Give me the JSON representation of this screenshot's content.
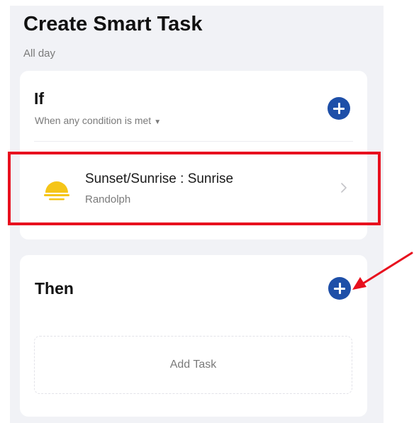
{
  "header": {
    "title": "Create Smart Task",
    "subtitle": "All day"
  },
  "if_section": {
    "title": "If",
    "condition_mode": "When any condition is met",
    "add_icon": "plus-circle-icon",
    "condition": {
      "icon": "sunrise-icon",
      "name": "Sunset/Sunrise : Sunrise",
      "location": "Randolph"
    }
  },
  "then_section": {
    "title": "Then",
    "add_icon": "plus-circle-icon",
    "add_task_label": "Add Task"
  },
  "annotations": {
    "highlight_color": "#e8101e",
    "arrow_color": "#e8101e"
  },
  "colors": {
    "accent": "#1e4fa8",
    "background": "#f1f2f6",
    "sun": "#f5c518"
  }
}
